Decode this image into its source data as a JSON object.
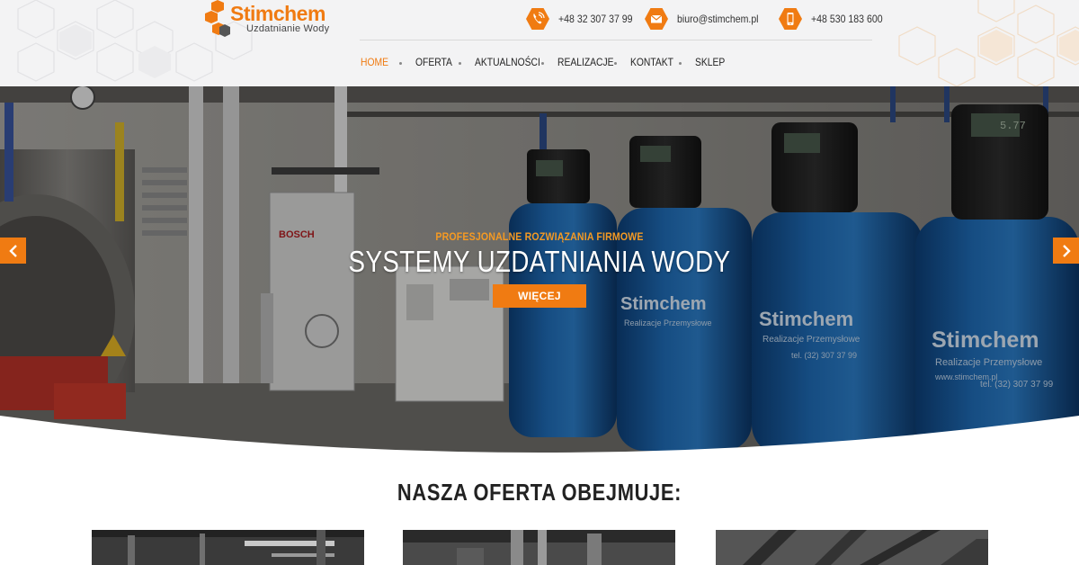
{
  "brand": {
    "name": "Stimchem",
    "tagline": "Uzdatnianie Wody",
    "accent": "#f07b12",
    "accent_light": "#f59a23"
  },
  "contacts": [
    {
      "icon": "phone-call-icon",
      "text": "+48 32 307 37 99"
    },
    {
      "icon": "envelope-icon",
      "text": "biuro@stimchem.pl"
    },
    {
      "icon": "mobile-phone-icon",
      "text": "+48 530 183 600"
    }
  ],
  "nav": {
    "items": [
      {
        "label": "HOME",
        "active": true
      },
      {
        "label": "OFERTA",
        "active": false
      },
      {
        "label": "AKTUALNOŚCI",
        "active": false
      },
      {
        "label": "REALIZACJE",
        "active": false
      },
      {
        "label": "KONTAKT",
        "active": false
      },
      {
        "label": "SKLEP",
        "active": false
      }
    ]
  },
  "hero": {
    "kicker": "PROFESJONALNE ROZWIĄZANIA FIRMOWE",
    "title": "SYSTEMY UZDATNIANIA WODY",
    "button_label": "WIĘCEJ",
    "prev_icon": "chevron-left-icon",
    "next_icon": "chevron-right-icon",
    "tank_brand": "Stimchem",
    "tank_sub": "Realizacje Przemysłowe",
    "tank_phone": "tel. (32) 307 37 99",
    "tank_web": "www.stimchem.pl",
    "panel_brand": "BOSCH",
    "meter_reading": "5.77"
  },
  "offer": {
    "title": "NASZA OFERTA OBEJMUJE:"
  }
}
